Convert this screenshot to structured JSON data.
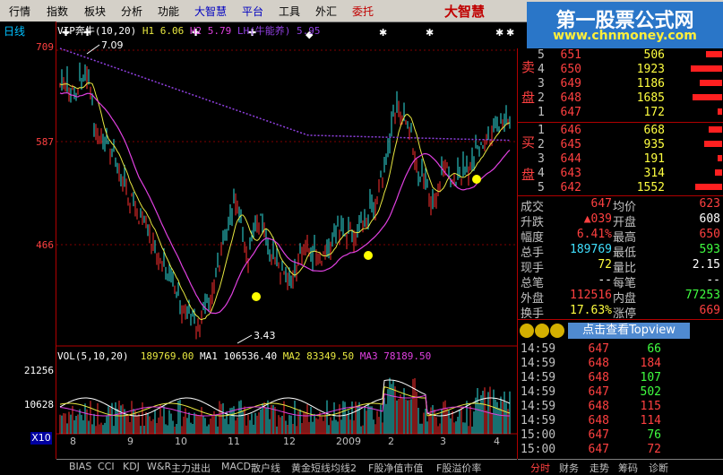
{
  "menu": [
    "行情",
    "指数",
    "板块",
    "分析",
    "功能",
    "大智慧",
    "平台",
    "工具",
    "外汇",
    "委托"
  ],
  "brand": "大智慧",
  "watermark": {
    "line1": "第一股票公式网",
    "line2": "www.chnmoney.com"
  },
  "period": "日线",
  "chart_legend": {
    "title": "VIP奔牛(10,20)",
    "h1": "H1 6.06",
    "h2": "H2 5.79",
    "lh": "LH(牛能养)",
    "lh_val": "5.95"
  },
  "price_axis": [
    "709",
    "587",
    "466"
  ],
  "annotations": {
    "high": "7.09",
    "low": "3.43"
  },
  "volume_legend": {
    "name": "VOL(5,10,20)",
    "vol": "189769.00",
    "ma1": "MA1 106536.40",
    "ma2": "MA2 83349.50",
    "ma3": "MA3 78189.50"
  },
  "volume_axis": [
    "21256",
    "10628"
  ],
  "x10": "X10",
  "date_axis": [
    "8",
    "9",
    "10",
    "11",
    "12",
    "2009",
    "2",
    "3",
    "4"
  ],
  "bottom_tabs": [
    "BIAS",
    "CCI",
    "KDJ",
    "W&R",
    "主力进出",
    "MACD",
    "散户线",
    "黄金短线均线2",
    "F股净值市值",
    "F股溢价率"
  ],
  "right_tabs": [
    "分时",
    "财务",
    "走势",
    "筹码",
    "诊断"
  ],
  "orderbook": {
    "sell_label": [
      "卖",
      "盘"
    ],
    "buy_label": [
      "买",
      "盘"
    ],
    "sell": [
      {
        "lvl": "5",
        "price": "651",
        "vol": "506",
        "bar": 0.35
      },
      {
        "lvl": "4",
        "price": "650",
        "vol": "1923",
        "bar": 0.7
      },
      {
        "lvl": "3",
        "price": "649",
        "vol": "1186",
        "bar": 0.5
      },
      {
        "lvl": "2",
        "price": "648",
        "vol": "1685",
        "bar": 0.65
      },
      {
        "lvl": "1",
        "price": "647",
        "vol": "172",
        "bar": 0.1
      }
    ],
    "buy": [
      {
        "lvl": "1",
        "price": "646",
        "vol": "668",
        "bar": 0.3
      },
      {
        "lvl": "2",
        "price": "645",
        "vol": "935",
        "bar": 0.4
      },
      {
        "lvl": "3",
        "price": "644",
        "vol": "191",
        "bar": 0.1
      },
      {
        "lvl": "4",
        "price": "643",
        "vol": "314",
        "bar": 0.15
      },
      {
        "lvl": "5",
        "price": "642",
        "vol": "1552",
        "bar": 0.6
      }
    ]
  },
  "stats": [
    {
      "k": "成交",
      "v": "647",
      "vc": "red",
      "k2": "均价",
      "v2": "623",
      "v2c": "red"
    },
    {
      "k": "升跌",
      "v": "▲039",
      "vc": "red",
      "k2": "开盘",
      "v2": "608",
      "v2c": "white"
    },
    {
      "k": "幅度",
      "v": "6.41%",
      "vc": "red",
      "k2": "最高",
      "v2": "650",
      "v2c": "red"
    },
    {
      "k": "总手",
      "v": "189769",
      "vc": "cyan",
      "k2": "最低",
      "v2": "593",
      "v2c": "green"
    },
    {
      "k": "现手",
      "v": "72",
      "vc": "yellow",
      "k2": "量比",
      "v2": "2.15",
      "v2c": "white"
    },
    {
      "k": "总笔",
      "v": "--",
      "vc": "white",
      "k2": "每笔",
      "v2": "--",
      "v2c": "white"
    },
    {
      "k": "外盘",
      "v": "112516",
      "vc": "red",
      "k2": "内盘",
      "v2": "77253",
      "v2c": "green"
    },
    {
      "k": "换手",
      "v": "17.63%",
      "vc": "yellow",
      "k2": "涨停",
      "v2": "669",
      "v2c": "red"
    }
  ],
  "topview_label": "点击查看Topview",
  "ticks": [
    {
      "t": "14:59",
      "p": "647",
      "v": "66",
      "c": "green"
    },
    {
      "t": "14:59",
      "p": "648",
      "v": "184",
      "c": "red"
    },
    {
      "t": "14:59",
      "p": "648",
      "v": "107",
      "c": "green"
    },
    {
      "t": "14:59",
      "p": "647",
      "v": "502",
      "c": "green"
    },
    {
      "t": "14:59",
      "p": "648",
      "v": "115",
      "c": "red"
    },
    {
      "t": "14:59",
      "p": "648",
      "v": "114",
      "c": "red"
    },
    {
      "t": "15:00",
      "p": "647",
      "v": "76",
      "c": "green"
    },
    {
      "t": "15:00",
      "p": "647",
      "v": "72",
      "c": "red"
    }
  ]
}
